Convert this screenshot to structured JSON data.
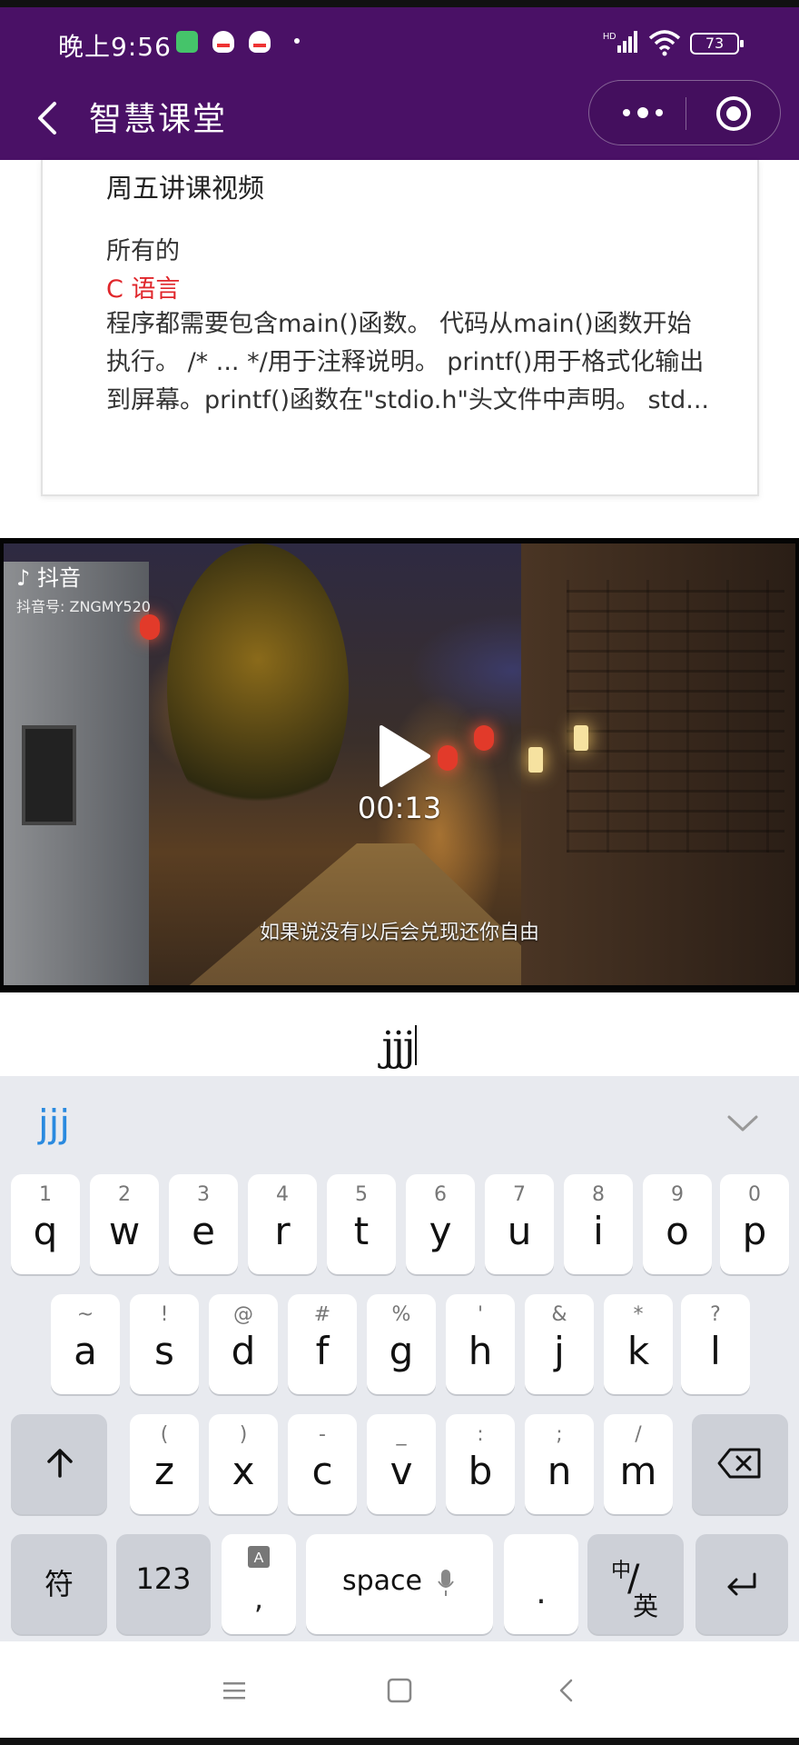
{
  "status_bar": {
    "time": "晚上9:56",
    "battery": "73"
  },
  "nav": {
    "title": "智慧课堂"
  },
  "card": {
    "title": "周五讲课视频",
    "line1": "所有的",
    "line2": "C 语言",
    "body": "程序都需要包含main()函数。 代码从main()函数开始执行。 /* ... */用于注释说明。 printf()用于格式化输出到屏幕。printf()函数在\"stdio.h\"头文件中声明。 std..."
  },
  "video": {
    "platform": "抖音",
    "account": "抖音号: ZNGMY520",
    "duration": "00:13",
    "subtitle": "如果说没有以后会兑现还你自由"
  },
  "input": {
    "value": "jjj"
  },
  "keyboard": {
    "candidate": "jjj",
    "row1": [
      {
        "sub": "1",
        "main": "q"
      },
      {
        "sub": "2",
        "main": "w"
      },
      {
        "sub": "3",
        "main": "e"
      },
      {
        "sub": "4",
        "main": "r"
      },
      {
        "sub": "5",
        "main": "t"
      },
      {
        "sub": "6",
        "main": "y"
      },
      {
        "sub": "7",
        "main": "u"
      },
      {
        "sub": "8",
        "main": "i"
      },
      {
        "sub": "9",
        "main": "o"
      },
      {
        "sub": "0",
        "main": "p"
      }
    ],
    "row2": [
      {
        "sub": "~",
        "main": "a"
      },
      {
        "sub": "!",
        "main": "s"
      },
      {
        "sub": "@",
        "main": "d"
      },
      {
        "sub": "#",
        "main": "f"
      },
      {
        "sub": "%",
        "main": "g"
      },
      {
        "sub": "'",
        "main": "h"
      },
      {
        "sub": "&",
        "main": "j"
      },
      {
        "sub": "*",
        "main": "k"
      },
      {
        "sub": "?",
        "main": "l"
      }
    ],
    "row3": [
      {
        "sub": "(",
        "main": "z"
      },
      {
        "sub": ")",
        "main": "x"
      },
      {
        "sub": "-",
        "main": "c"
      },
      {
        "sub": "_",
        "main": "v"
      },
      {
        "sub": ":",
        "main": "b"
      },
      {
        "sub": ";",
        "main": "n"
      },
      {
        "sub": "/",
        "main": "m"
      }
    ],
    "symbols_label": "符",
    "numbers_label": "123",
    "comma_label": ",",
    "space_label": "space",
    "period_label": ".",
    "lang_zh": "中",
    "lang_en": "英"
  },
  "colors": {
    "header": "#4a1166",
    "accent_red": "#e0262b",
    "candidate": "#2a8adf"
  }
}
